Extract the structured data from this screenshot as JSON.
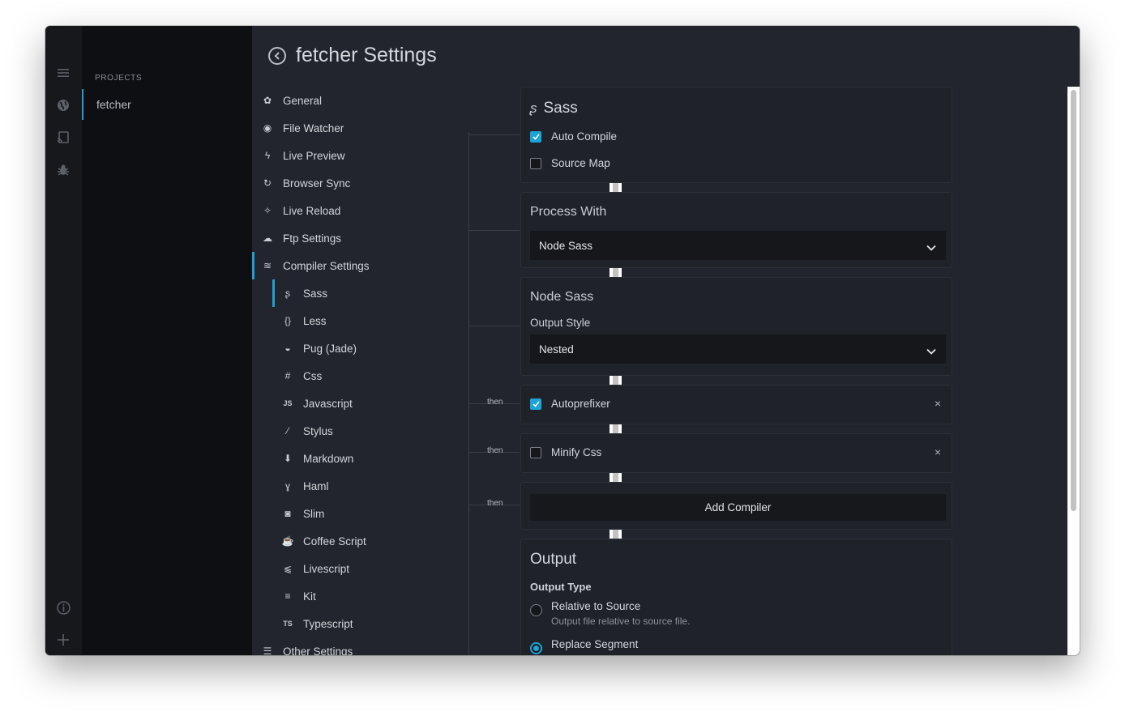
{
  "projects": {
    "header": "PROJECTS",
    "items": [
      {
        "label": "fetcher"
      }
    ]
  },
  "rail_icons": [
    "menu-icon",
    "globe-icon",
    "cast-icon",
    "bug-icon",
    "info-icon",
    "plus-icon"
  ],
  "page": {
    "title": "fetcher Settings"
  },
  "nav": {
    "items": [
      {
        "label": "General",
        "icon": "gear-icon"
      },
      {
        "label": "File Watcher",
        "icon": "eye-icon"
      },
      {
        "label": "Live Preview",
        "icon": "bolt-icon"
      },
      {
        "label": "Browser Sync",
        "icon": "sync-icon"
      },
      {
        "label": "Live Reload",
        "icon": "magic-icon"
      },
      {
        "label": "Ftp Settings",
        "icon": "cloud-upload-icon"
      },
      {
        "label": "Compiler Settings",
        "icon": "layers-icon"
      },
      {
        "label": "Sass",
        "icon": "sass-icon"
      },
      {
        "label": "Less",
        "icon": "braces-icon"
      },
      {
        "label": "Pug (Jade)",
        "icon": "pug-icon"
      },
      {
        "label": "Css",
        "icon": "hash-icon"
      },
      {
        "label": "Javascript",
        "icon": "js-icon"
      },
      {
        "label": "Stylus",
        "icon": "stylus-icon"
      },
      {
        "label": "Markdown",
        "icon": "markdown-icon"
      },
      {
        "label": "Haml",
        "icon": "haml-icon"
      },
      {
        "label": "Slim",
        "icon": "slim-icon"
      },
      {
        "label": "Coffee Script",
        "icon": "coffee-icon"
      },
      {
        "label": "Livescript",
        "icon": "livescript-icon"
      },
      {
        "label": "Kit",
        "icon": "kit-icon"
      },
      {
        "label": "Typescript",
        "icon": "ts-icon"
      },
      {
        "label": "Other Settings",
        "icon": "list-icon"
      }
    ]
  },
  "sass_card": {
    "title": "Sass",
    "auto_compile": {
      "label": "Auto Compile",
      "checked": true
    },
    "source_map": {
      "label": "Source Map",
      "checked": false
    }
  },
  "process_card": {
    "title": "Process With",
    "selected": "Node Sass"
  },
  "node_sass_card": {
    "title": "Node Sass",
    "output_style_label": "Output Style",
    "output_style_value": "Nested"
  },
  "pipeline": {
    "then_label": "then",
    "autoprefixer": {
      "label": "Autoprefixer",
      "checked": true
    },
    "minify": {
      "label": "Minify Css",
      "checked": false
    },
    "add_compiler": "Add Compiler",
    "remove_symbol": "×"
  },
  "output_card": {
    "title": "Output",
    "type_label": "Output Type",
    "options": [
      {
        "label": "Relative to Source",
        "desc": "Output file relative to source file.",
        "selected": false
      },
      {
        "label": "Replace Segment",
        "selected": true
      }
    ]
  },
  "colors": {
    "accent": "#1e9fd0",
    "bg": "#22252d",
    "card": "#1f2228"
  }
}
